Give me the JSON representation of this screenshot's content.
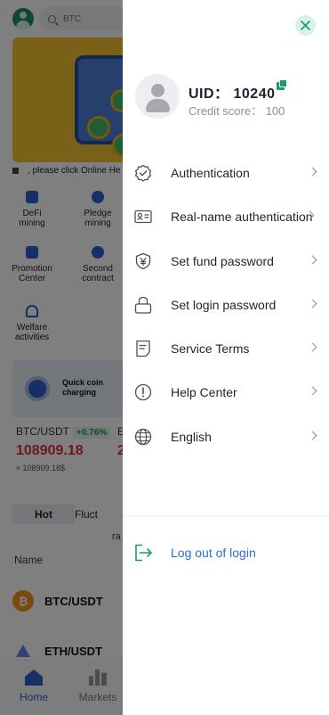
{
  "background": {
    "search": {
      "text": "BTC"
    },
    "notice": ", please click Online He",
    "grid": [
      {
        "label1": "DeFi",
        "label2": "mining"
      },
      {
        "label1": "Pledge",
        "label2": "mining"
      },
      {
        "label1": "Promotion",
        "label2": "Center"
      },
      {
        "label1": "Second",
        "label2": "contract"
      },
      {
        "label1": "Welfare",
        "label2": "activities"
      }
    ],
    "quick": {
      "line1": "Quick coin",
      "line2": "charging"
    },
    "ticker": {
      "pair": "BTC/USDT",
      "change": "+0.76%",
      "pair2_prefix": "E",
      "price": "108909.18",
      "price2_prefix": "2",
      "approx": "≈ 108909.18$"
    },
    "tabs": {
      "hot": "Hot",
      "fluct": "Fluct",
      "sub": "ra"
    },
    "list_header": "Name",
    "rows": [
      {
        "symbol": "BTC/USDT"
      },
      {
        "symbol": "ETH/USDT"
      }
    ],
    "nav": {
      "home": "Home",
      "markets": "Markets"
    }
  },
  "drawer": {
    "uid": "UID： 10240",
    "credit": "Credit score： 100",
    "menu": [
      {
        "label": "Authentication",
        "icon": "badge-check-icon"
      },
      {
        "label": "Real-name authentication",
        "icon": "id-card-icon"
      },
      {
        "label": "Set fund password",
        "icon": "shield-yen-icon"
      },
      {
        "label": "Set login password",
        "icon": "lock-icon"
      },
      {
        "label": "Service Terms",
        "icon": "document-icon"
      },
      {
        "label": "Help Center",
        "icon": "info-icon"
      },
      {
        "label": "English",
        "icon": "globe-icon"
      }
    ],
    "logout": {
      "label": "Log out of login",
      "icon": "logout-icon"
    }
  },
  "colors": {
    "accent_green": "#1b9b67",
    "link_blue": "#2b6fd1",
    "price_red": "#d9333f"
  }
}
